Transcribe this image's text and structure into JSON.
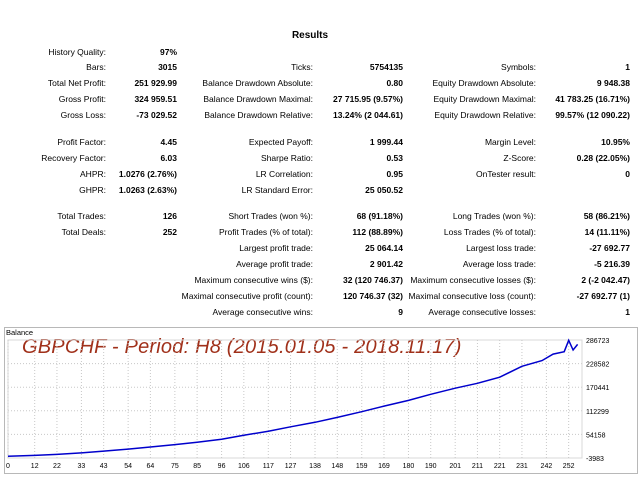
{
  "report": {
    "title": "Results",
    "rows": [
      [
        {
          "label": "History Quality:",
          "value": "97%"
        }
      ],
      [
        {
          "label": "Bars:",
          "value": "3015"
        },
        {
          "label": "Ticks:",
          "value": "5754135"
        },
        {
          "label": "Symbols:",
          "value": "1"
        }
      ],
      [
        {
          "label": "Total Net Profit:",
          "value": "251 929.99"
        },
        {
          "label": "Balance Drawdown Absolute:",
          "value": "0.80"
        },
        {
          "label": "Equity Drawdown Absolute:",
          "value": "9 948.38"
        }
      ],
      [
        {
          "label": "Gross Profit:",
          "value": "324 959.51"
        },
        {
          "label": "Balance Drawdown Maximal:",
          "value": "27 715.95 (9.57%)"
        },
        {
          "label": "Equity Drawdown Maximal:",
          "value": "41 783.25 (16.71%)"
        }
      ],
      [
        {
          "label": "Gross Loss:",
          "value": "-73 029.52"
        },
        {
          "label": "Balance Drawdown Relative:",
          "value": "13.24% (2 044.61)"
        },
        {
          "label": "Equity Drawdown Relative:",
          "value": "99.57% (12 090.22)"
        }
      ],
      [
        {
          "label": "Profit Factor:",
          "value": "4.45"
        },
        {
          "label": "Expected Payoff:",
          "value": "1 999.44"
        },
        {
          "label": "Margin Level:",
          "value": "10.95%"
        }
      ],
      [
        {
          "label": "Recovery Factor:",
          "value": "6.03"
        },
        {
          "label": "Sharpe Ratio:",
          "value": "0.53"
        },
        {
          "label": "Z-Score:",
          "value": "0.28 (22.05%)"
        }
      ],
      [
        {
          "label": "AHPR:",
          "value": "1.0276 (2.76%)"
        },
        {
          "label": "LR Correlation:",
          "value": "0.95"
        },
        {
          "label": "OnTester result:",
          "value": "0"
        }
      ],
      [
        {
          "label": "GHPR:",
          "value": "1.0263 (2.63%)"
        },
        {
          "label": "LR Standard Error:",
          "value": "25 050.52"
        }
      ],
      [
        {
          "label": "Total Trades:",
          "value": "126"
        },
        {
          "label": "Short Trades (won %):",
          "value": "68 (91.18%)"
        },
        {
          "label": "Long Trades (won %):",
          "value": "58 (86.21%)"
        }
      ],
      [
        {
          "label": "Total Deals:",
          "value": "252"
        },
        {
          "label": "Profit Trades (% of total):",
          "value": "112 (88.89%)"
        },
        {
          "label": "Loss Trades (% of total):",
          "value": "14 (11.11%)"
        }
      ],
      [
        {
          "label": "Largest profit trade:",
          "value": "25 064.14"
        },
        {
          "label": "Largest loss trade:",
          "value": "-27 692.77"
        }
      ],
      [
        {
          "label": "Average profit trade:",
          "value": "2 901.42"
        },
        {
          "label": "Average loss trade:",
          "value": "-5 216.39"
        }
      ],
      [
        {
          "label": "Maximum consecutive wins ($):",
          "value": "32 (120 746.37)"
        },
        {
          "label": "Maximum consecutive losses ($):",
          "value": "2 (-2 042.47)"
        }
      ],
      [
        {
          "label": "Maximal consecutive profit (count):",
          "value": "120 746.37 (32)"
        },
        {
          "label": "Maximal consecutive loss (count):",
          "value": "-27 692.77 (1)"
        }
      ],
      [
        {
          "label": "Average consecutive wins:",
          "value": "9"
        },
        {
          "label": "Average consecutive losses:",
          "value": "1"
        }
      ]
    ]
  },
  "chart_header": "Balance",
  "overlay_text": "GBPCHF - Period: H8 (2015.01.05 - 2018.11.17)",
  "chart_data": {
    "type": "line",
    "series_color": "#0000cc",
    "ylim": [
      -3983,
      286723
    ],
    "xlim": [
      0,
      258
    ],
    "x_ticks": [
      "0",
      "12",
      "22",
      "33",
      "43",
      "54",
      "64",
      "75",
      "85",
      "96",
      "106",
      "117",
      "127",
      "138",
      "148",
      "159",
      "169",
      "180",
      "190",
      "201",
      "211",
      "221",
      "231",
      "242",
      "252"
    ],
    "y_ticks": [
      "286723",
      "228582",
      "170441",
      "112299",
      "54158",
      "-3983"
    ],
    "x": [
      0,
      12,
      22,
      33,
      43,
      54,
      64,
      75,
      85,
      96,
      106,
      117,
      127,
      138,
      148,
      159,
      169,
      180,
      190,
      201,
      211,
      221,
      231,
      240,
      245,
      250,
      252,
      254,
      256
    ],
    "values": [
      500,
      2500,
      5000,
      8500,
      13000,
      18000,
      23000,
      29000,
      35000,
      42000,
      52000,
      62000,
      73000,
      84000,
      96000,
      110000,
      124000,
      138000,
      153000,
      168000,
      180000,
      195000,
      222000,
      236000,
      252000,
      258000,
      286000,
      262000,
      276000
    ]
  }
}
